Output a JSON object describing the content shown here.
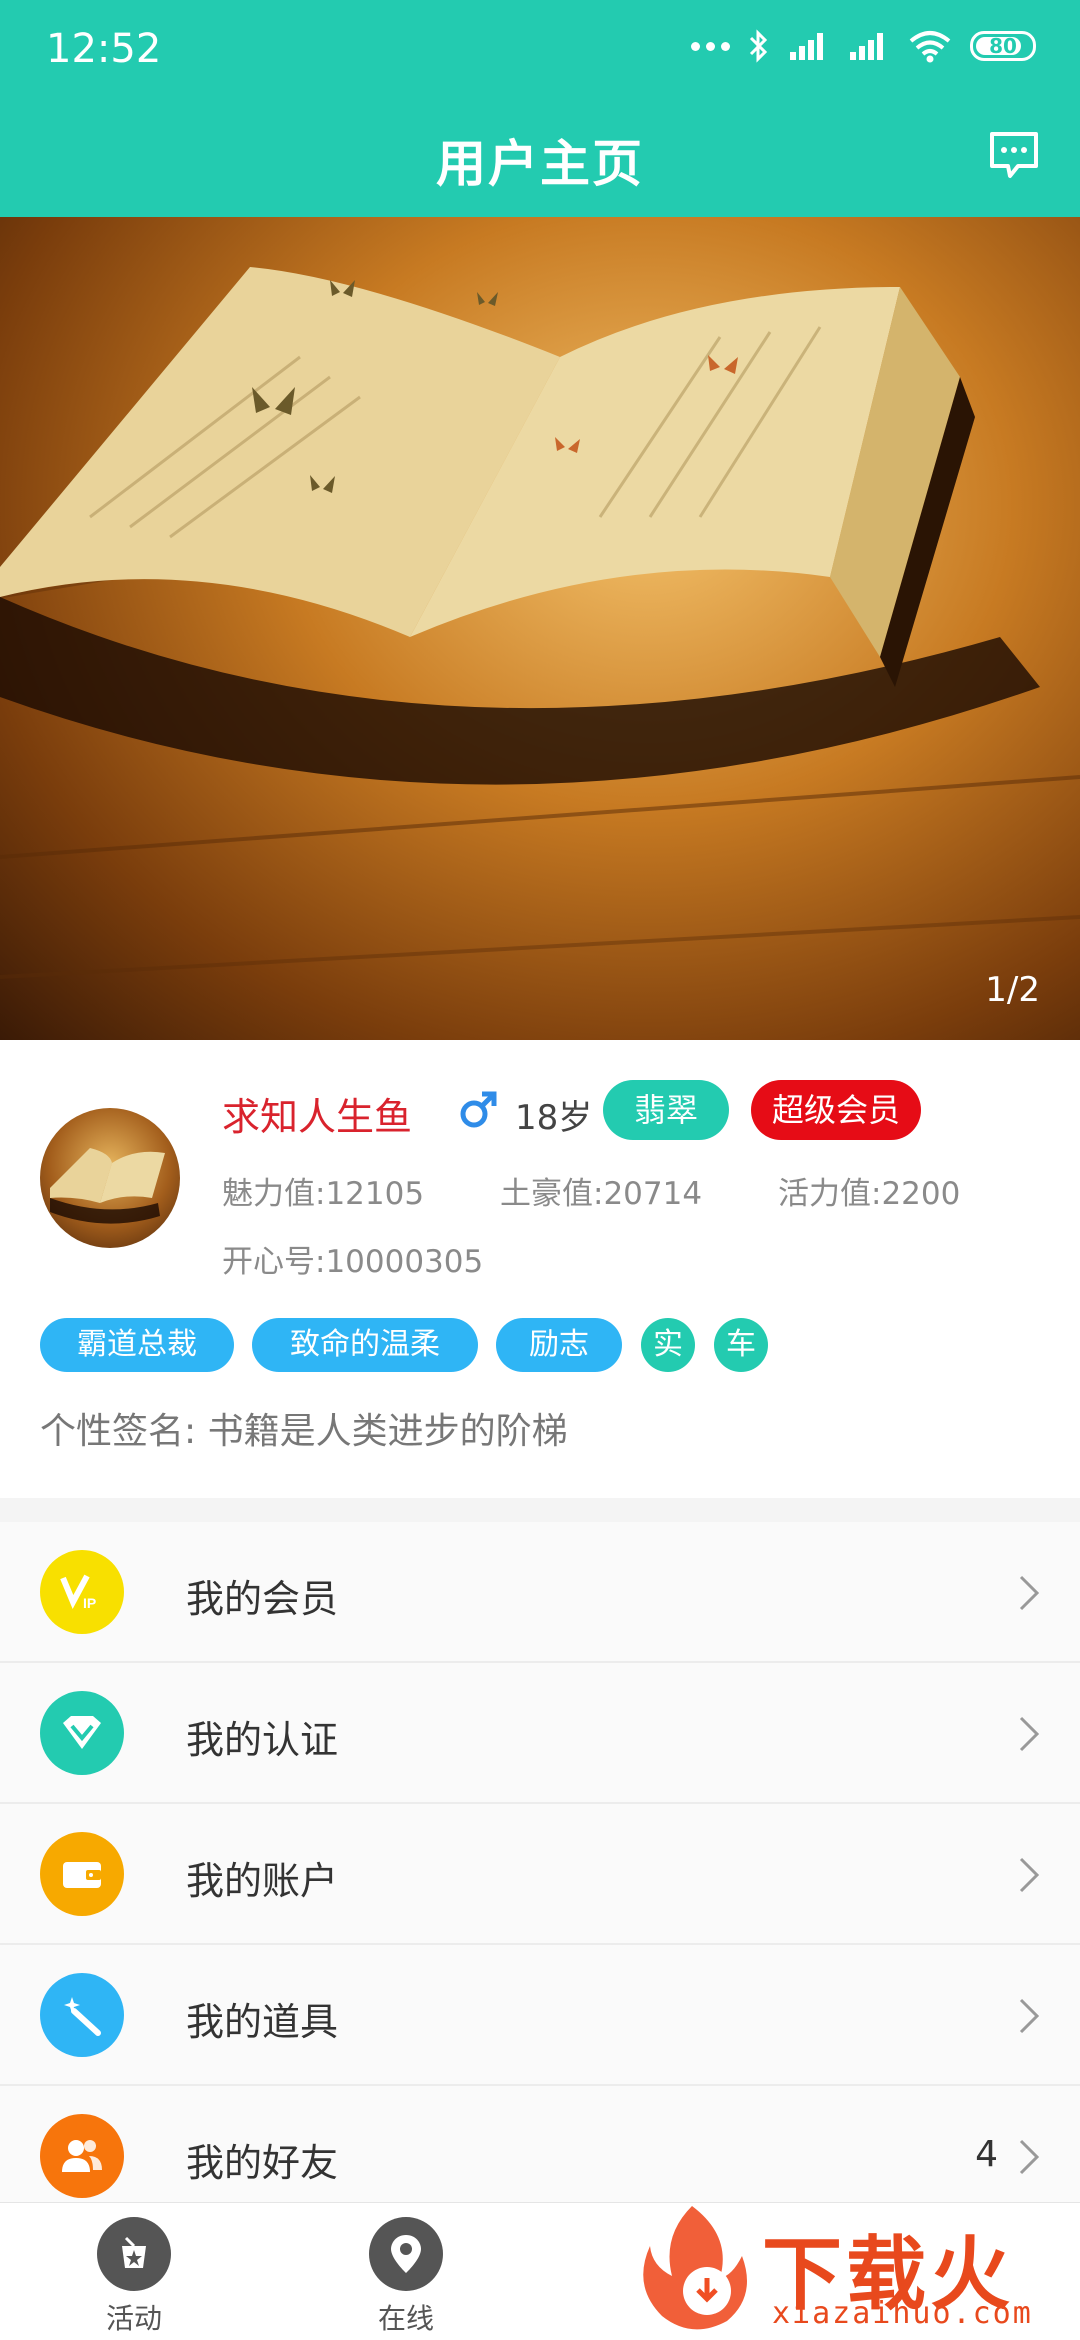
{
  "status": {
    "time": "12:52",
    "battery": "80"
  },
  "header": {
    "title": "用户主页"
  },
  "hero": {
    "pager": "1/2"
  },
  "profile": {
    "username": "求知人生鱼",
    "age": "18岁",
    "badge_level": "翡翠",
    "badge_vip": "超级会员",
    "charm": "魅力值:12105",
    "wealth": "土豪值:20714",
    "vitality": "活力值:2200",
    "kx_id": "开心号:10000305",
    "tags": [
      "霸道总裁",
      "致命的温柔",
      "励志"
    ],
    "round_tags": [
      "实",
      "车"
    ],
    "signature": "个性签名: 书籍是人类进步的阶梯"
  },
  "menu": {
    "items": [
      {
        "label": "我的会员",
        "icon": "vip-icon",
        "color": "#f8e000"
      },
      {
        "label": "我的认证",
        "icon": "diamond-icon",
        "color": "#23cbb0"
      },
      {
        "label": "我的账户",
        "icon": "wallet-icon",
        "color": "#f7a900"
      },
      {
        "label": "我的道具",
        "icon": "magic-wand-icon",
        "color": "#2fb5f5"
      },
      {
        "label": "我的好友",
        "icon": "friends-icon",
        "color": "#f7750c",
        "count": "4"
      }
    ]
  },
  "bottom_nav": {
    "items": [
      {
        "label": "活动",
        "icon": "activity-icon"
      },
      {
        "label": "在线",
        "icon": "location-pin-icon"
      }
    ]
  },
  "watermark": {
    "brand": "下载火",
    "domain": "xiazaihuo.com"
  }
}
